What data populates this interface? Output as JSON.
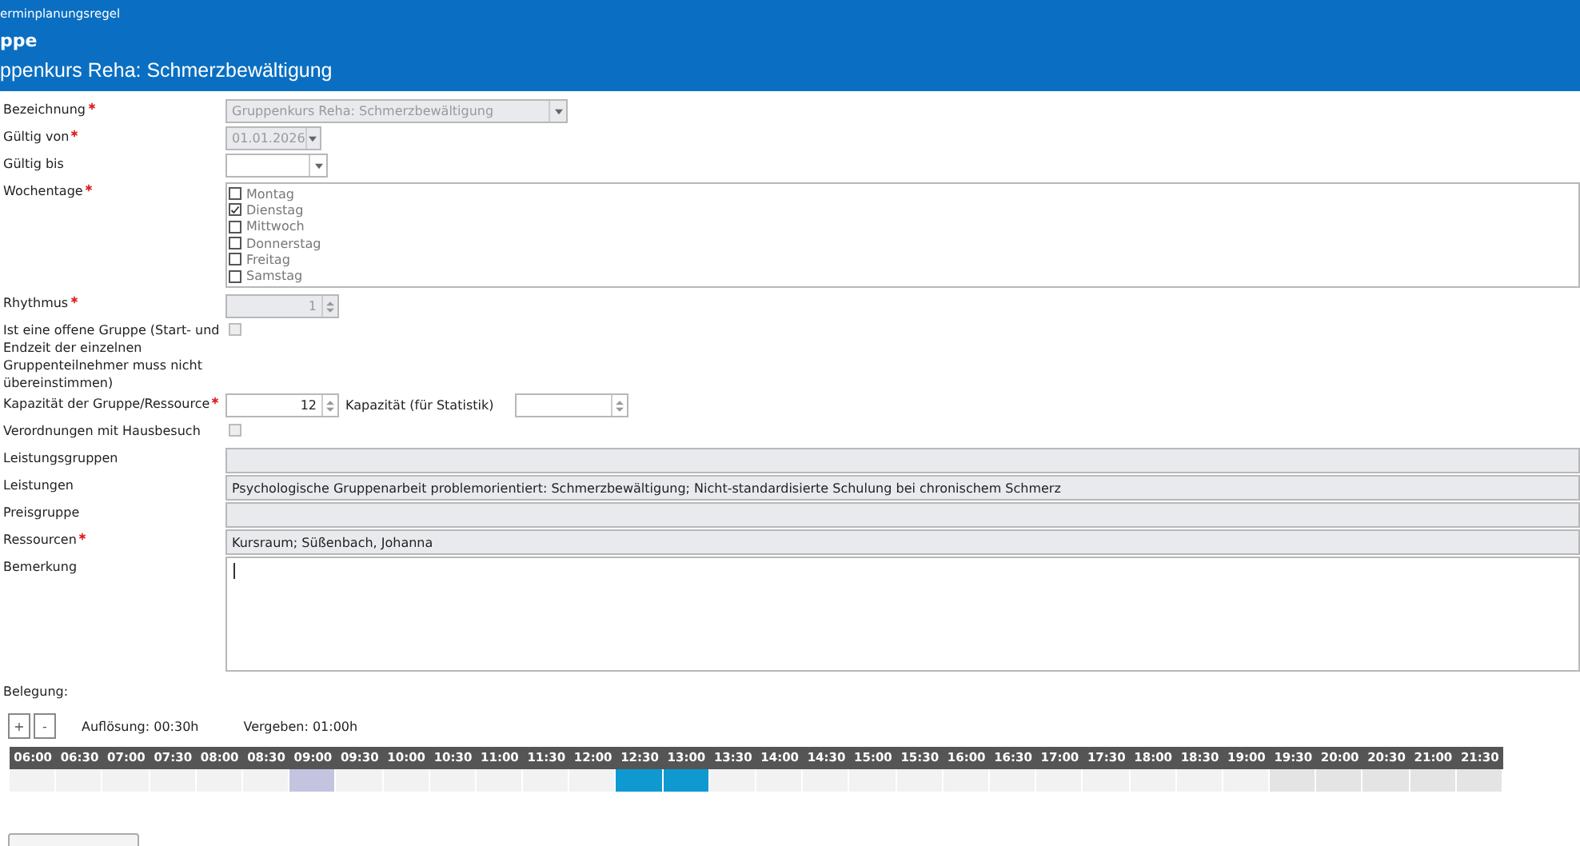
{
  "header": {
    "breadcrumb": "erminplanungsregel",
    "section": "ppe",
    "title": "ppenkurs Reha: Schmerzbewältigung"
  },
  "fields": [
    {
      "kind": "combo",
      "label": "Bezeichnung",
      "required": true,
      "value": "Gruppenkurs Reha: Schmerzbewältigung",
      "disabled": true
    },
    {
      "kind": "date",
      "label": "Gültig von",
      "required": true,
      "value": "01.01.2026",
      "disabled": true
    },
    {
      "kind": "date",
      "label": "Gültig bis",
      "required": false,
      "disabled": false
    },
    {
      "kind": "checklist",
      "label": "Wochentage",
      "required": true,
      "items": [
        {
          "label": "Montag",
          "checked": false
        },
        {
          "label": "Dienstag",
          "checked": true
        },
        {
          "label": "Mittwoch",
          "checked": false
        },
        {
          "label": "Donnerstag",
          "checked": false
        },
        {
          "label": "Freitag",
          "checked": false
        },
        {
          "label": "Samstag",
          "checked": false
        }
      ]
    },
    {
      "kind": "spin",
      "label": "Rhythmus",
      "required": true,
      "value": "1",
      "disabled": true
    },
    {
      "kind": "checkbox",
      "label": "Ist eine offene Gruppe (Start- und Endzeit der einzelnen Gruppenteilnehmer muss nicht übereinstimmen)",
      "required": false,
      "checked": false,
      "disabled": true
    },
    {
      "kind": "spin-pair",
      "label": "Kapazität der Gruppe/Ressource",
      "required": true,
      "value": "12",
      "second_label": "Kapazität (für Statistik)",
      "disabled": false
    },
    {
      "kind": "checkbox",
      "label": "Verordnungen mit Hausbesuch",
      "required": false,
      "checked": false,
      "disabled": true
    },
    {
      "kind": "text",
      "label": "Leistungsgruppen",
      "required": false,
      "disabled": true
    },
    {
      "kind": "text",
      "label": "Leistungen",
      "required": false,
      "value": "Psychologische Gruppenarbeit problemorientiert: Schmerzbewältigung; Nicht-standardisierte Schulung bei chronischem Schmerz",
      "disabled": true
    },
    {
      "kind": "text",
      "label": "Preisgruppe",
      "required": false,
      "disabled": true
    },
    {
      "kind": "text",
      "label": "Ressourcen",
      "required": true,
      "value": "Kursraum; Süßenbach, Johanna",
      "disabled": true
    },
    {
      "kind": "textarea",
      "label": "Bemerkung",
      "required": false,
      "disabled": false
    }
  ],
  "occupancy": {
    "label": "Belegung:",
    "zoom_in": "+",
    "zoom_out": "-",
    "resolution": "Auflösung: 00:30h",
    "assigned": "Vergeben: 01:00h",
    "slots": [
      {
        "time": "06:00",
        "kind": "free"
      },
      {
        "time": "06:30",
        "kind": "free"
      },
      {
        "time": "07:00",
        "kind": "free"
      },
      {
        "time": "07:30",
        "kind": "free"
      },
      {
        "time": "08:00",
        "kind": "free"
      },
      {
        "time": "08:30",
        "kind": "free"
      },
      {
        "time": "09:00",
        "kind": "reserved"
      },
      {
        "time": "09:30",
        "kind": "free"
      },
      {
        "time": "10:00",
        "kind": "free"
      },
      {
        "time": "10:30",
        "kind": "free"
      },
      {
        "time": "11:00",
        "kind": "free"
      },
      {
        "time": "11:30",
        "kind": "free"
      },
      {
        "time": "12:00",
        "kind": "free"
      },
      {
        "time": "12:30",
        "kind": "booked"
      },
      {
        "time": "13:00",
        "kind": "booked"
      },
      {
        "time": "13:30",
        "kind": "free"
      },
      {
        "time": "14:00",
        "kind": "free"
      },
      {
        "time": "14:30",
        "kind": "free"
      },
      {
        "time": "15:00",
        "kind": "free"
      },
      {
        "time": "15:30",
        "kind": "free"
      },
      {
        "time": "16:00",
        "kind": "free"
      },
      {
        "time": "16:30",
        "kind": "free"
      },
      {
        "time": "17:00",
        "kind": "free"
      },
      {
        "time": "17:30",
        "kind": "free"
      },
      {
        "time": "18:00",
        "kind": "free"
      },
      {
        "time": "18:30",
        "kind": "free"
      },
      {
        "time": "19:00",
        "kind": "free"
      },
      {
        "time": "19:30",
        "kind": "closed"
      },
      {
        "time": "20:00",
        "kind": "closed"
      },
      {
        "time": "20:30",
        "kind": "closed"
      },
      {
        "time": "21:00",
        "kind": "closed"
      },
      {
        "time": "21:30",
        "kind": "closed"
      }
    ]
  }
}
